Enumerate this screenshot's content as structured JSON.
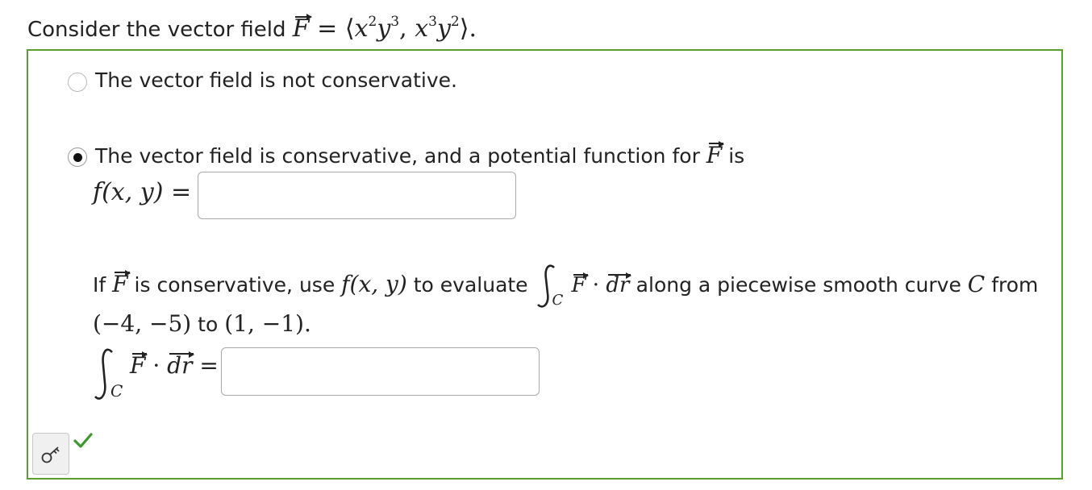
{
  "question": {
    "prompt_prefix": "Consider the vector field",
    "field_symbol": "F",
    "field_equals": "=",
    "field_value_open": "⟨",
    "field_value_close": "⟩.",
    "comp1": {
      "a": "x",
      "p": "2",
      "b": "y",
      "q": "3"
    },
    "comp2": {
      "a": "x",
      "p": "3",
      "b": "y",
      "q": "2"
    },
    "comma": ","
  },
  "options": [
    {
      "label": "The vector field is not conservative.",
      "selected": false
    },
    {
      "label_prefix": "The vector field is conservative, and a potential function for",
      "label_suffix": "is",
      "selected": true
    }
  ],
  "potential": {
    "lhs": "f(x, y)",
    "equals": "=",
    "value": ""
  },
  "evaluate": {
    "text1": "If",
    "text2": "is conservative, use",
    "func": "f(x, y)",
    "text3": "to evaluate",
    "text4": "along a piecewise smooth curve",
    "curve": "C",
    "text5": "from",
    "start": "(−4, −5)",
    "to": "to",
    "end": "(1, −1).",
    "integrand_dot": "·",
    "dr": "dr",
    "sub": "C",
    "equals": "=",
    "value": ""
  },
  "controls": {
    "key_icon": "key-icon",
    "check_icon": "checkmark-icon",
    "check_color": "#3a9a2a",
    "border_color": "#5aa02c"
  }
}
